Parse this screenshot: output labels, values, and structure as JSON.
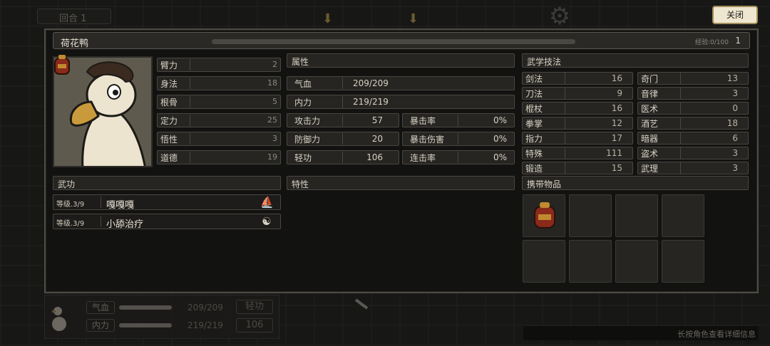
{
  "top": {
    "round_label": "回合 1",
    "close_label": "关闭"
  },
  "character": {
    "name": "荷花鸭",
    "exp_label": "经验:0/100",
    "level": "1"
  },
  "base_stats": [
    {
      "label": "臂力",
      "value": "2"
    },
    {
      "label": "身法",
      "value": "18"
    },
    {
      "label": "根骨",
      "value": "5"
    },
    {
      "label": "定力",
      "value": "25"
    },
    {
      "label": "悟性",
      "value": "3"
    },
    {
      "label": "道德",
      "value": "19"
    }
  ],
  "attributes": {
    "header": "属性",
    "hp": {
      "label": "气血",
      "value": "209/209"
    },
    "mp": {
      "label": "内力",
      "value": "219/219"
    },
    "rows": [
      {
        "label": "攻击力",
        "value": "57",
        "label2": "暴击率",
        "value2": "0%"
      },
      {
        "label": "防御力",
        "value": "20",
        "label2": "暴击伤害",
        "value2": "0%"
      },
      {
        "label": "轻功",
        "value": "106",
        "label2": "连击率",
        "value2": "0%"
      }
    ]
  },
  "traits": {
    "header": "特性"
  },
  "wugong": {
    "header": "武功",
    "items": [
      {
        "level": "等级.3/9",
        "name": "嘎嘎嘎",
        "icon": "sail-icon"
      },
      {
        "level": "等级.3/9",
        "name": "小舔治疗",
        "icon": "yin-yang-icon"
      }
    ]
  },
  "martial_arts": {
    "header": "武学技法",
    "left": [
      {
        "label": "剑法",
        "value": "16"
      },
      {
        "label": "刀法",
        "value": "9"
      },
      {
        "label": "棍杖",
        "value": "16"
      },
      {
        "label": "拳掌",
        "value": "12"
      },
      {
        "label": "指力",
        "value": "17"
      },
      {
        "label": "特殊",
        "value": "111"
      },
      {
        "label": "锻造",
        "value": "15"
      }
    ],
    "right": [
      {
        "label": "奇门",
        "value": "13"
      },
      {
        "label": "音律",
        "value": "3"
      },
      {
        "label": "医术",
        "value": "0"
      },
      {
        "label": "酒艺",
        "value": "18"
      },
      {
        "label": "暗器",
        "value": "6"
      },
      {
        "label": "盗术",
        "value": "3"
      },
      {
        "label": "武理",
        "value": "3"
      }
    ]
  },
  "inventory": {
    "header": "携带物品"
  },
  "hud": {
    "hp_label": "气血",
    "hp_value": "209/209",
    "mp_label": "内力",
    "mp_value": "219/219",
    "speed_label": "轻功",
    "speed_value": "106"
  },
  "hint": "长按角色查看详细信息",
  "colors": {
    "close_button_bg": "#efe6cf",
    "panel_bg": "#121211",
    "row_bg": "#262522"
  }
}
